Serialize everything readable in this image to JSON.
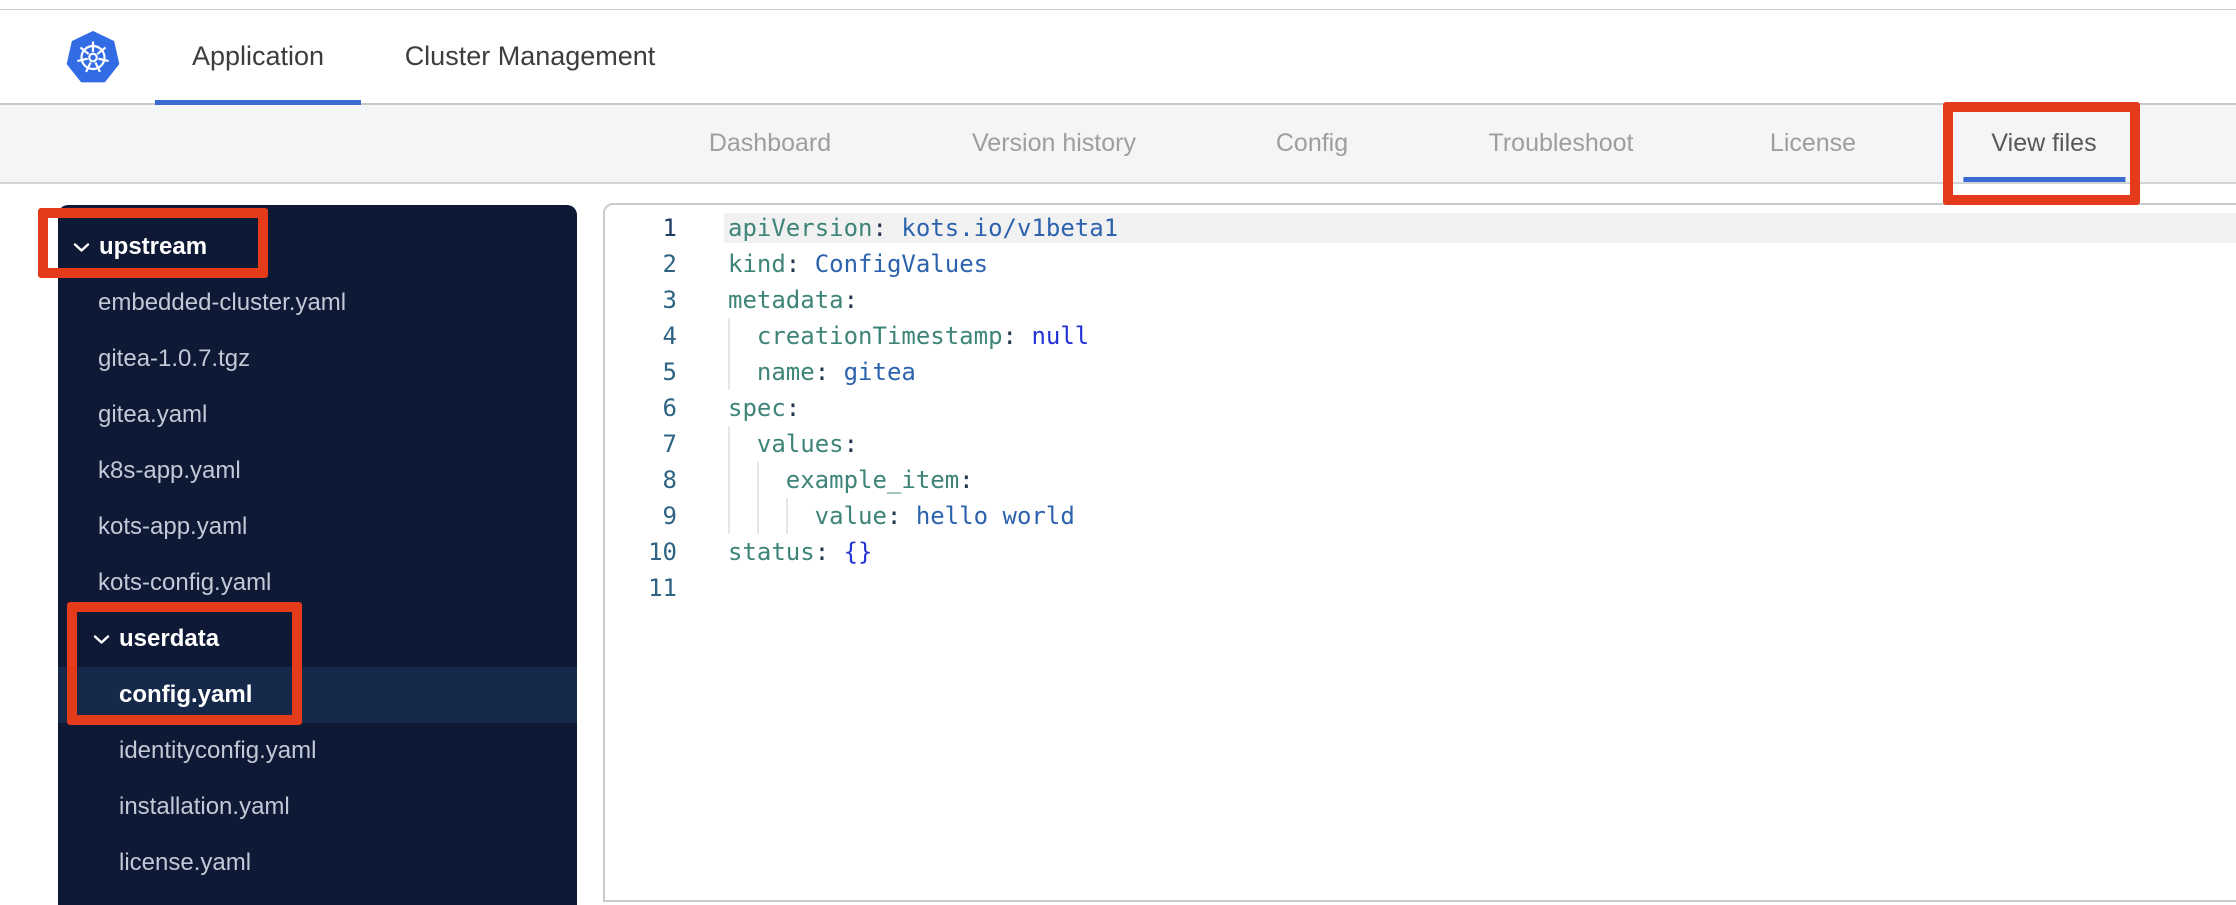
{
  "header": {
    "tabs": [
      {
        "label": "Application",
        "active": true
      },
      {
        "label": "Cluster Management",
        "active": false
      }
    ]
  },
  "subnav": {
    "tabs": [
      {
        "label": "Dashboard",
        "active": false
      },
      {
        "label": "Version history",
        "active": false
      },
      {
        "label": "Config",
        "active": false
      },
      {
        "label": "Troubleshoot",
        "active": false
      },
      {
        "label": "License",
        "active": false
      },
      {
        "label": "View files",
        "active": true
      }
    ]
  },
  "sidebar": {
    "rows": [
      {
        "type": "folder",
        "label": "upstream",
        "depth": 0,
        "expanded": true,
        "selected": false
      },
      {
        "type": "file",
        "label": "embedded-cluster.yaml",
        "depth": 0,
        "selected": false
      },
      {
        "type": "file",
        "label": "gitea-1.0.7.tgz",
        "depth": 0,
        "selected": false
      },
      {
        "type": "file",
        "label": "gitea.yaml",
        "depth": 0,
        "selected": false
      },
      {
        "type": "file",
        "label": "k8s-app.yaml",
        "depth": 0,
        "selected": false
      },
      {
        "type": "file",
        "label": "kots-app.yaml",
        "depth": 0,
        "selected": false
      },
      {
        "type": "file",
        "label": "kots-config.yaml",
        "depth": 0,
        "selected": false
      },
      {
        "type": "folder",
        "label": "userdata",
        "depth": 1,
        "expanded": true,
        "selected": false
      },
      {
        "type": "file",
        "label": "config.yaml",
        "depth": 1,
        "selected": true
      },
      {
        "type": "file",
        "label": "identityconfig.yaml",
        "depth": 1,
        "selected": false
      },
      {
        "type": "file",
        "label": "installation.yaml",
        "depth": 1,
        "selected": false
      },
      {
        "type": "file",
        "label": "license.yaml",
        "depth": 1,
        "selected": false
      }
    ]
  },
  "editor": {
    "filename": "config.yaml",
    "lines": [
      {
        "n": 1,
        "active": true,
        "guides": 0,
        "tokens": [
          [
            "k",
            "apiVersion"
          ],
          [
            "p",
            ": "
          ],
          [
            "v",
            "kots.io/v1beta1"
          ]
        ]
      },
      {
        "n": 2,
        "active": false,
        "guides": 0,
        "tokens": [
          [
            "k",
            "kind"
          ],
          [
            "p",
            ": "
          ],
          [
            "v",
            "ConfigValues"
          ]
        ]
      },
      {
        "n": 3,
        "active": false,
        "guides": 0,
        "tokens": [
          [
            "k",
            "metadata"
          ],
          [
            "p",
            ":"
          ]
        ]
      },
      {
        "n": 4,
        "active": false,
        "guides": 1,
        "tokens": [
          [
            "k",
            "creationTimestamp"
          ],
          [
            "p",
            ": "
          ],
          [
            "w",
            "null"
          ]
        ]
      },
      {
        "n": 5,
        "active": false,
        "guides": 1,
        "tokens": [
          [
            "k",
            "name"
          ],
          [
            "p",
            ": "
          ],
          [
            "v",
            "gitea"
          ]
        ]
      },
      {
        "n": 6,
        "active": false,
        "guides": 0,
        "tokens": [
          [
            "k",
            "spec"
          ],
          [
            "p",
            ":"
          ]
        ]
      },
      {
        "n": 7,
        "active": false,
        "guides": 1,
        "tokens": [
          [
            "k",
            "values"
          ],
          [
            "p",
            ":"
          ]
        ]
      },
      {
        "n": 8,
        "active": false,
        "guides": 2,
        "tokens": [
          [
            "k",
            "example_item"
          ],
          [
            "p",
            ":"
          ]
        ]
      },
      {
        "n": 9,
        "active": false,
        "guides": 3,
        "tokens": [
          [
            "k",
            "value"
          ],
          [
            "p",
            ": "
          ],
          [
            "v",
            "hello world"
          ]
        ]
      },
      {
        "n": 10,
        "active": false,
        "guides": 0,
        "tokens": [
          [
            "k",
            "status"
          ],
          [
            "p",
            ": "
          ],
          [
            "w",
            "{}"
          ]
        ]
      },
      {
        "n": 11,
        "active": false,
        "guides": 0,
        "tokens": []
      }
    ]
  },
  "colors": {
    "accent_blue": "#3b6ad4",
    "k8s_blue": "#326ce5",
    "annotation_red": "#e43c1a",
    "sidebar_bg": "#0d1935",
    "sidebar_selected_bg": "#16294a",
    "sidebar_file_text": "#c2c9d6",
    "subnav_bg": "#f4f5f6",
    "syntax_key": "#3e8478",
    "syntax_value": "#2d63ae",
    "syntax_keyword": "#2533d6",
    "syntax_punct": "#22344f",
    "gutter_text": "#2f6384",
    "gutter_active_text": "#1d3a63",
    "active_line_bg": "#f1f1f2"
  }
}
